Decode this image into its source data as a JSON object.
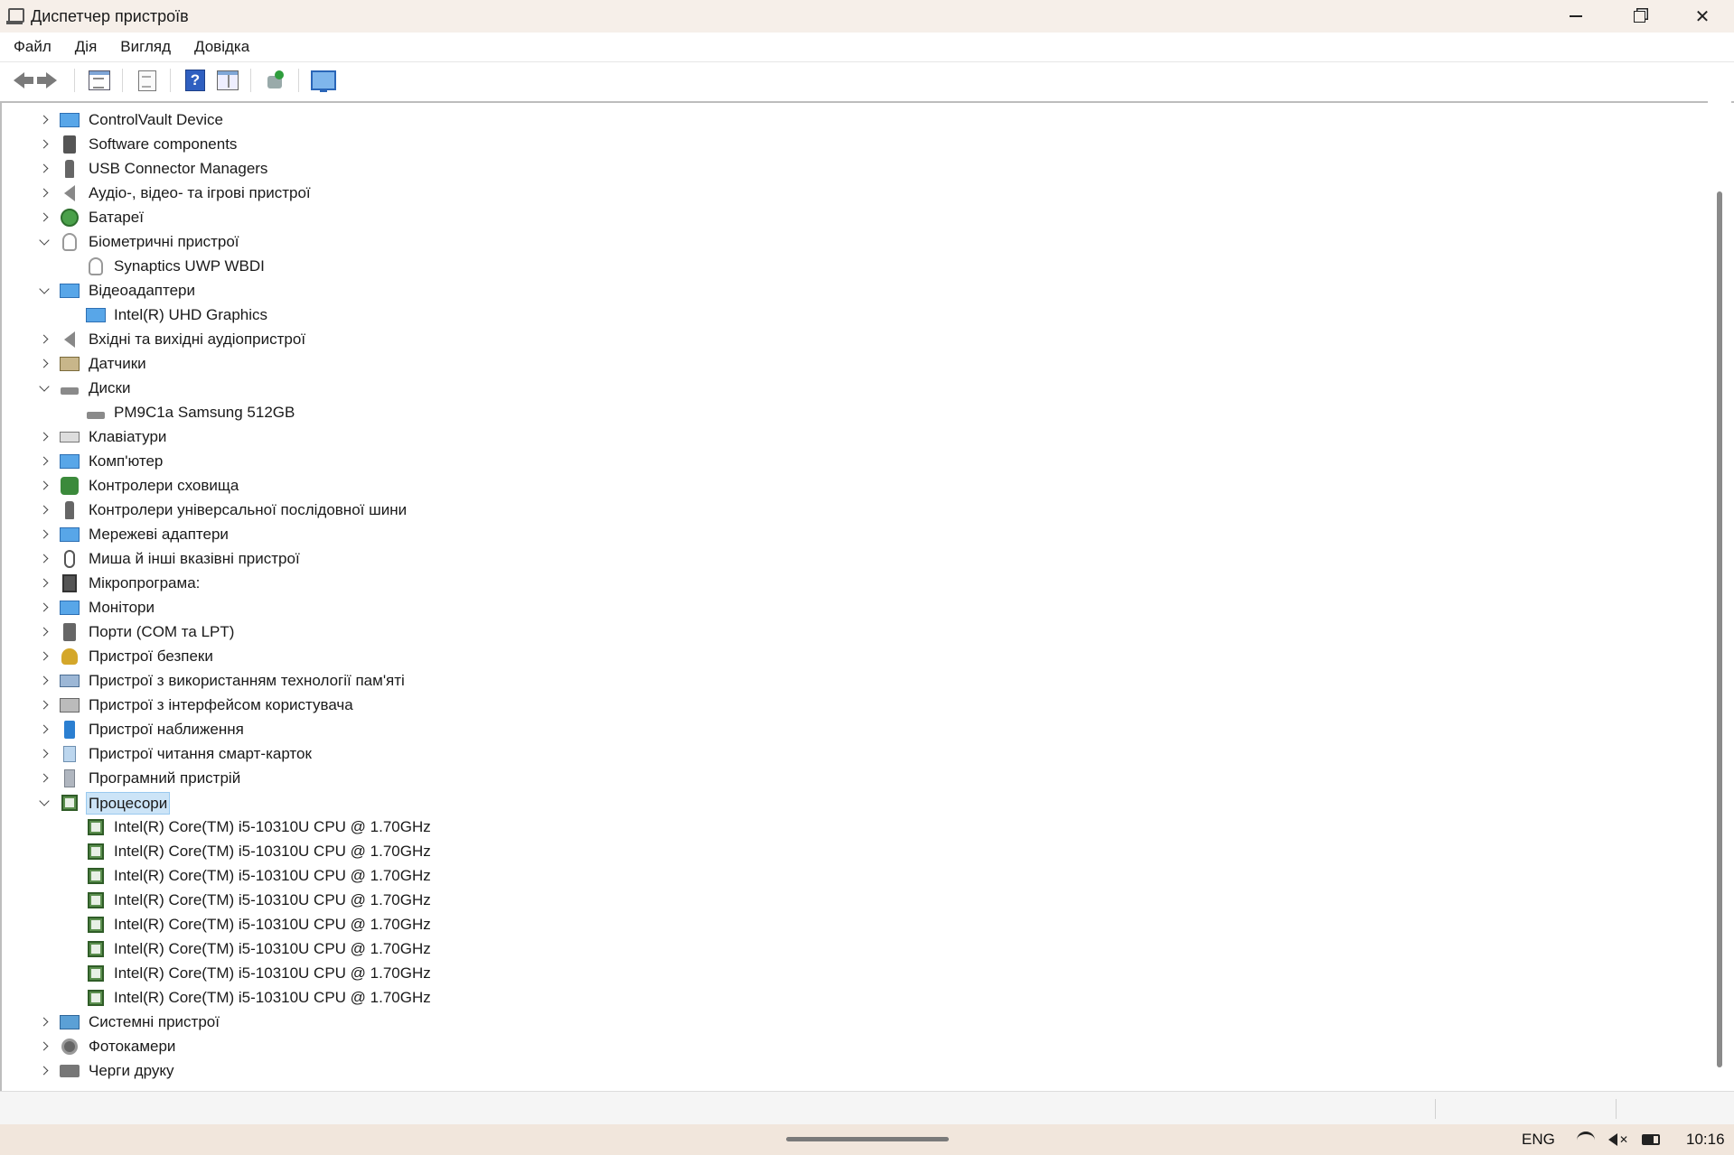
{
  "window": {
    "title": "Диспетчер пристроїв"
  },
  "menu": [
    "Файл",
    "Дія",
    "Вигляд",
    "Довідка"
  ],
  "tree": [
    {
      "label": "ControlVault Device",
      "icon": "monitor-icon",
      "expanded": false
    },
    {
      "label": "Software components",
      "icon": "component-icon",
      "expanded": false
    },
    {
      "label": "USB Connector Managers",
      "icon": "usb-icon",
      "expanded": false
    },
    {
      "label": "Аудіо-, відео- та ігрові пристрої",
      "icon": "speaker-icon",
      "expanded": false
    },
    {
      "label": "Батареї",
      "icon": "battery-icon",
      "expanded": false
    },
    {
      "label": "Біометричні пристрої",
      "icon": "fingerprint-icon",
      "expanded": true,
      "children": [
        {
          "label": "Synaptics UWP WBDI",
          "icon": "fingerprint-icon"
        }
      ]
    },
    {
      "label": "Відеоадаптери",
      "icon": "monitor-icon",
      "expanded": true,
      "children": [
        {
          "label": "Intel(R) UHD Graphics",
          "icon": "monitor-icon"
        }
      ]
    },
    {
      "label": "Вхідні та вихідні аудіопристрої",
      "icon": "speaker-icon",
      "expanded": false
    },
    {
      "label": "Датчики",
      "icon": "sensor-icon",
      "expanded": false
    },
    {
      "label": "Диски",
      "icon": "disk-icon",
      "expanded": true,
      "children": [
        {
          "label": "PM9C1a Samsung 512GB",
          "icon": "disk-icon"
        }
      ]
    },
    {
      "label": "Клавіатури",
      "icon": "keyboard-icon",
      "expanded": false
    },
    {
      "label": "Комп'ютер",
      "icon": "monitor-icon",
      "expanded": false
    },
    {
      "label": "Контролери сховища",
      "icon": "storage-icon",
      "expanded": false
    },
    {
      "label": "Контролери універсальної послідовної шини",
      "icon": "usb-icon",
      "expanded": false
    },
    {
      "label": "Мережеві адаптери",
      "icon": "network-icon",
      "expanded": false
    },
    {
      "label": "Миша й інші вказівні пристрої",
      "icon": "mouse-icon",
      "expanded": false
    },
    {
      "label": "Мікропрограма:",
      "icon": "firmware-icon",
      "expanded": false
    },
    {
      "label": "Монітори",
      "icon": "monitor-icon",
      "expanded": false
    },
    {
      "label": "Порти (COM та LPT)",
      "icon": "port-icon",
      "expanded": false
    },
    {
      "label": "Пристрої безпеки",
      "icon": "security-key-icon",
      "expanded": false
    },
    {
      "label": "Пристрої з використанням технології пам'яті",
      "icon": "memory-icon",
      "expanded": false
    },
    {
      "label": "Пристрої з інтерфейсом користувача",
      "icon": "hid-icon",
      "expanded": false
    },
    {
      "label": "Пристрої наближення",
      "icon": "proximity-icon",
      "expanded": false
    },
    {
      "label": "Пристрої читання смарт-карток",
      "icon": "smartcard-icon",
      "expanded": false
    },
    {
      "label": "Програмний пристрій",
      "icon": "software-device-icon",
      "expanded": false
    },
    {
      "label": "Процесори",
      "icon": "cpu-icon",
      "expanded": true,
      "selected": true,
      "children": [
        {
          "label": "Intel(R) Core(TM) i5-10310U CPU @ 1.70GHz",
          "icon": "cpu-icon"
        },
        {
          "label": "Intel(R) Core(TM) i5-10310U CPU @ 1.70GHz",
          "icon": "cpu-icon"
        },
        {
          "label": "Intel(R) Core(TM) i5-10310U CPU @ 1.70GHz",
          "icon": "cpu-icon"
        },
        {
          "label": "Intel(R) Core(TM) i5-10310U CPU @ 1.70GHz",
          "icon": "cpu-icon"
        },
        {
          "label": "Intel(R) Core(TM) i5-10310U CPU @ 1.70GHz",
          "icon": "cpu-icon"
        },
        {
          "label": "Intel(R) Core(TM) i5-10310U CPU @ 1.70GHz",
          "icon": "cpu-icon"
        },
        {
          "label": "Intel(R) Core(TM) i5-10310U CPU @ 1.70GHz",
          "icon": "cpu-icon"
        },
        {
          "label": "Intel(R) Core(TM) i5-10310U CPU @ 1.70GHz",
          "icon": "cpu-icon"
        }
      ]
    },
    {
      "label": "Системні пристрої",
      "icon": "system-icon",
      "expanded": false
    },
    {
      "label": "Фотокамери",
      "icon": "camera-icon",
      "expanded": false
    },
    {
      "label": "Черги друку",
      "icon": "printer-icon",
      "expanded": false
    }
  ],
  "taskbar": {
    "language": "ENG",
    "time": "10:16"
  },
  "colors": {
    "selection_bg": "#cce4f7",
    "titlebar_bg": "#f6efe9",
    "taskbar_bg": "#f1e6dc"
  }
}
